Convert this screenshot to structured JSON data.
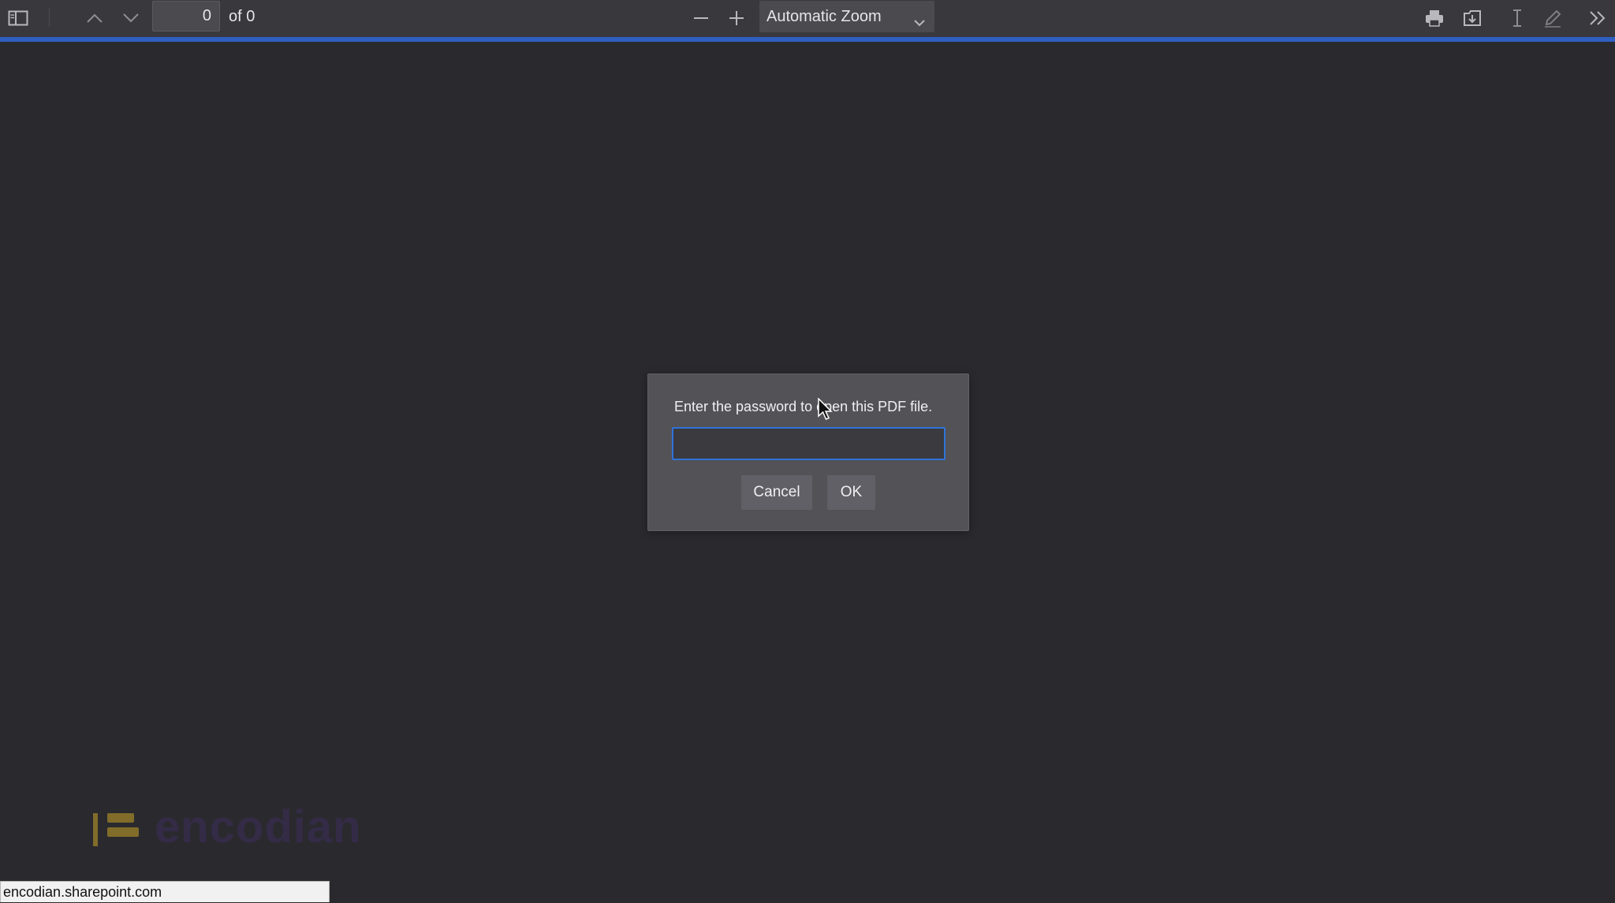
{
  "toolbar": {
    "page_number": "0",
    "page_count": "of 0",
    "zoom_value": "Automatic Zoom",
    "icons": {
      "sidebar": "sidebar-toggle-icon",
      "prev": "chevron-up-icon",
      "next": "chevron-down-icon",
      "zoom_out": "minus-icon",
      "zoom_in": "plus-icon",
      "print": "print-icon",
      "save": "download-icon",
      "text": "text-cursor-icon",
      "draw": "pen-icon",
      "more": "double-chevron-right-icon"
    }
  },
  "dialog": {
    "message": "Enter the password to open this PDF file.",
    "password_value": "",
    "cancel_label": "Cancel",
    "ok_label": "OK"
  },
  "watermark": {
    "text": "encodian"
  },
  "status_bar": {
    "url": "encodian.sharepoint.com"
  },
  "colors": {
    "background": "#2a2a2e",
    "toolbar": "#38383d",
    "accent": "#2f73d8",
    "progress": "#2f5fc2",
    "logo_gold": "#c9a227",
    "logo_purple": "#3d2d5c"
  }
}
